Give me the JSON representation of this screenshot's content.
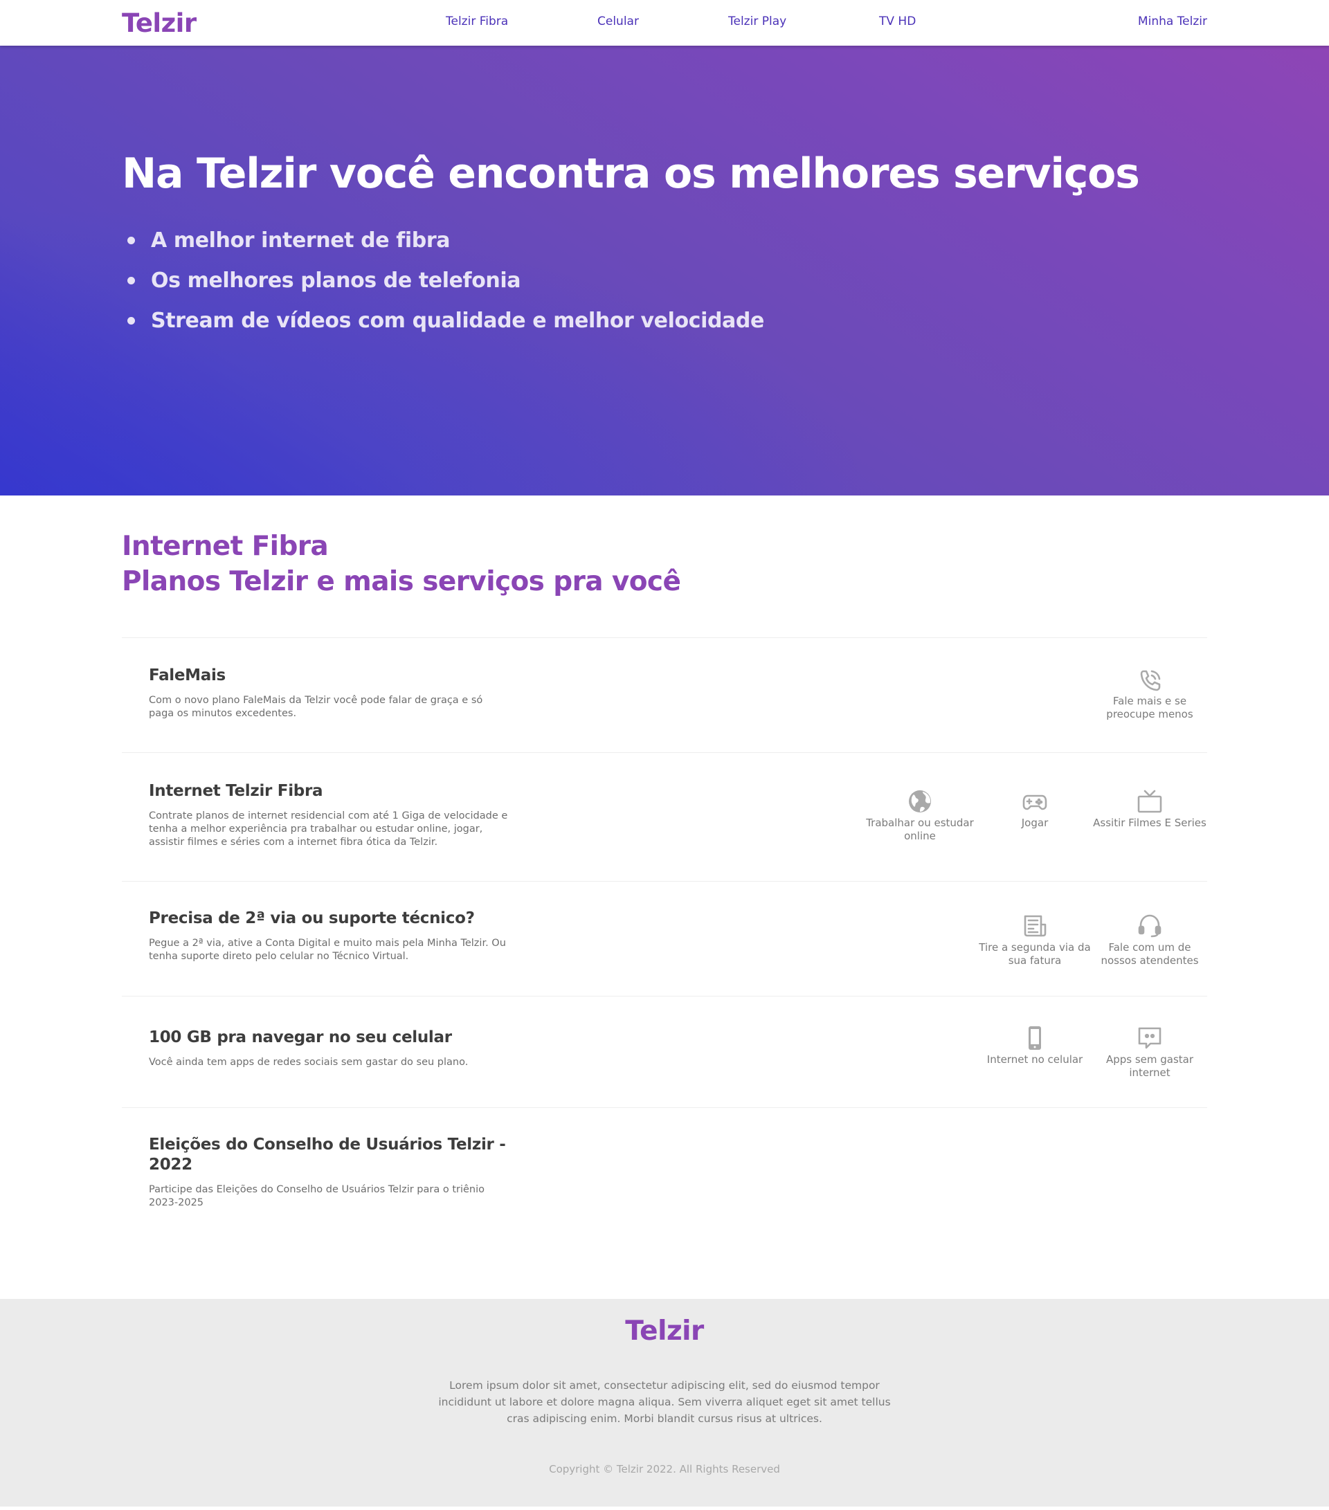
{
  "header": {
    "logo": "Telzir",
    "nav": [
      "Telzir Fibra",
      "Celular",
      "Telzir Play",
      "TV HD",
      "Minha Telzir"
    ]
  },
  "hero": {
    "title": "Na Telzir você encontra os melhores serviços",
    "bullets": [
      "A melhor internet de fibra",
      "Os melhores planos de telefonia",
      "Stream de vídeos com qualidade e melhor velocidade"
    ]
  },
  "section": {
    "title_line1": "Internet Fibra",
    "title_line2": "Planos Telzir e mais serviços pra você",
    "services": [
      {
        "title": "FaleMais",
        "description": "Com o novo plano FaleMais da Telzir você pode falar de graça e só paga os minutos excedentes.",
        "features": [
          {
            "icon": "phone-call-icon",
            "label": "Fale mais e se preocupe menos"
          }
        ]
      },
      {
        "title": "Internet Telzir Fibra",
        "description": "Contrate planos de internet residencial com até 1 Giga de velocidade e tenha a melhor experiência pra trabalhar ou estudar online, jogar, assistir filmes e séries com a internet fibra ótica da Telzir.",
        "features": [
          {
            "icon": "globe-icon",
            "label": "Trabalhar ou estudar online"
          },
          {
            "icon": "gamepad-icon",
            "label": "Jogar"
          },
          {
            "icon": "tv-icon",
            "label": "Assitir Filmes E Series"
          }
        ]
      },
      {
        "title": "Precisa de 2ª via ou suporte técnico?",
        "description": "Pegue a 2ª via, ative a Conta Digital e muito mais pela Minha Telzir. Ou tenha suporte direto pelo celular no Técnico Virtual.",
        "features": [
          {
            "icon": "invoice-icon",
            "label": "Tire a segunda via da sua fatura"
          },
          {
            "icon": "headset-icon",
            "label": "Fale com um de nossos atendentes"
          }
        ]
      },
      {
        "title": "100 GB pra navegar no seu celular",
        "description": "Você ainda tem apps de redes sociais sem gastar do seu plano.",
        "features": [
          {
            "icon": "smartphone-icon",
            "label": "Internet no celular"
          },
          {
            "icon": "chat-icon",
            "label": "Apps sem gastar internet"
          }
        ]
      },
      {
        "title": "Eleições do Conselho de Usuários Telzir - 2022",
        "description": "Participe das Eleições do Conselho de Usuários Telzir para o triênio 2023-2025",
        "features": []
      }
    ]
  },
  "footer": {
    "logo": "Telzir",
    "text": "Lorem ipsum dolor sit amet, consectetur adipiscing elit, sed do eiusmod tempor incididunt ut labore et dolore magna aliqua. Sem viverra aliquet eget sit amet tellus cras adipiscing enim. Morbi blandit cursus risus at ultrices.",
    "copyright": "Copyright © Telzir 2022. All Rights Reserved"
  },
  "colors": {
    "brand": "#8a45b5",
    "nav_link": "#4b32b8",
    "hero_gradient_start": "#3a33c9",
    "hero_gradient_end": "#8e45b6",
    "icon_gray": "#a9a9a9",
    "footer_bg": "#ebebeb"
  }
}
